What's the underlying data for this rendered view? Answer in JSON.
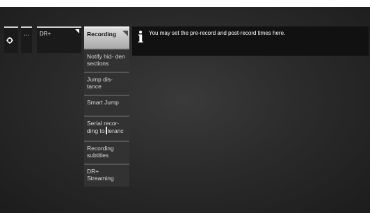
{
  "toolbar": {
    "dots_label": "...",
    "drplus_label": "DR+"
  },
  "submenu": {
    "items": [
      {
        "label": "Recording"
      },
      {
        "label": "Notify hid- den sections"
      },
      {
        "label": "Jump dis- tance"
      },
      {
        "label": "Smart Jump"
      },
      {
        "label_a": "Serial recor- ding to",
        "label_b": "leranc"
      },
      {
        "label": "Recording subtitles"
      },
      {
        "label": "DR+ Streaming"
      }
    ]
  },
  "info": {
    "icon": "info-icon",
    "text": "You may set the pre-record and post-record times here."
  },
  "colors": {
    "background": "#2b2b2b",
    "menu_bg": "#323232",
    "selected_bg": "#c8c8c8",
    "info_bg": "#111111"
  }
}
